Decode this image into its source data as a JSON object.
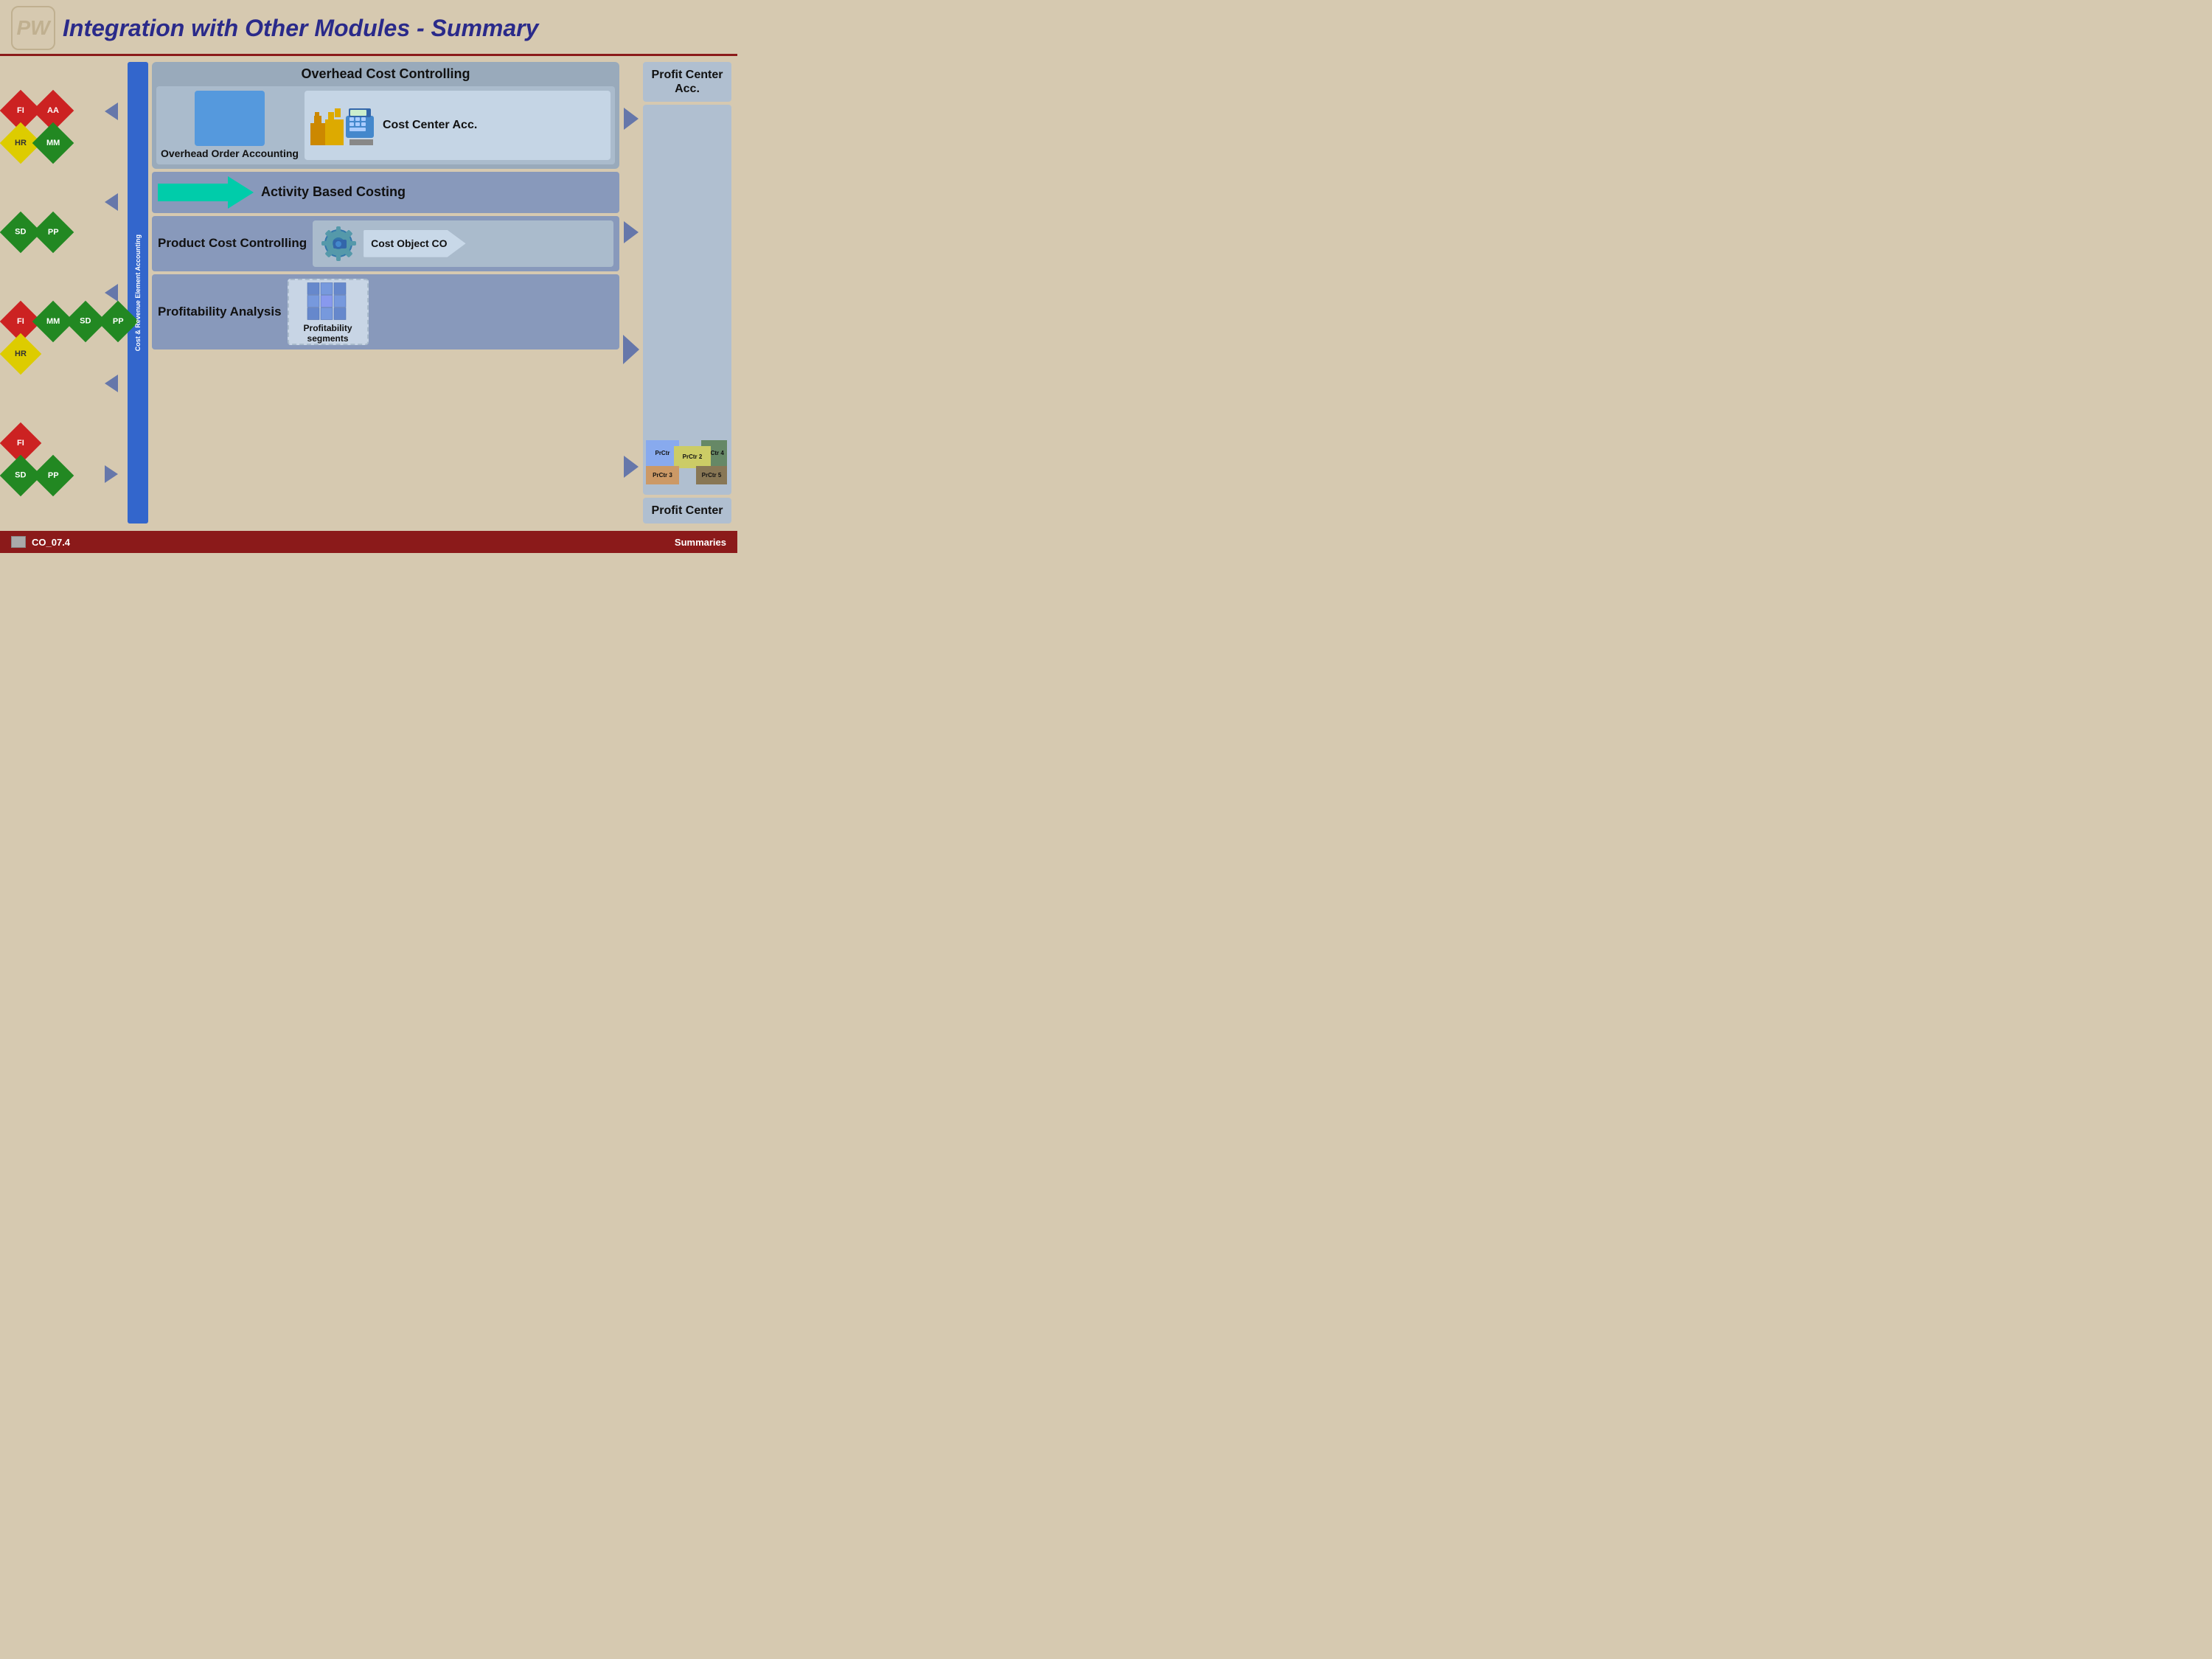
{
  "header": {
    "title": "Integration with Other Modules - Summary",
    "logo_text": "PW"
  },
  "footer": {
    "slide_id": "CO_07.4",
    "section": "Summaries"
  },
  "left_badges": {
    "group1": {
      "row1": [
        {
          "label": "FI",
          "color": "red"
        },
        {
          "label": "AA",
          "color": "red"
        }
      ],
      "row2": [
        {
          "label": "HR",
          "color": "yellow"
        },
        {
          "label": "MM",
          "color": "green"
        }
      ]
    },
    "group2": {
      "row1": [
        {
          "label": "SD",
          "color": "green"
        },
        {
          "label": "PP",
          "color": "green"
        }
      ]
    },
    "group3": {
      "row1": [
        {
          "label": "FI",
          "color": "red"
        },
        {
          "label": "MM",
          "color": "green"
        },
        {
          "label": "SD",
          "color": "green"
        },
        {
          "label": "PP",
          "color": "green"
        }
      ],
      "row2": [
        {
          "label": "HR",
          "color": "yellow"
        }
      ]
    },
    "group4": {
      "row1": [
        {
          "label": "FI",
          "color": "red"
        }
      ],
      "row2": [
        {
          "label": "SD",
          "color": "green"
        },
        {
          "label": "PP",
          "color": "green"
        }
      ]
    }
  },
  "vertical_bar": {
    "label": "Cost & Revenue Element Accounting"
  },
  "occ": {
    "title": "Overhead Cost Controlling",
    "ooa_label": "Overhead Order Accounting",
    "cost_center_label": "Cost Center Acc."
  },
  "abc": {
    "label": "Activity Based Costing"
  },
  "pcc": {
    "label": "Product Cost Controlling",
    "cost_obj_label": "Cost Object CO"
  },
  "prof": {
    "label": "Profitability Analysis",
    "seg_label": "Profitability segments"
  },
  "profit_center": {
    "top_label": "Profit Center Acc.",
    "bottom_label": "Profit Center",
    "prctr_labels": [
      "PrCtr",
      "PrCtr 4",
      "PrCtr 2",
      "PrCtr 3",
      "PrCtr 5"
    ]
  }
}
